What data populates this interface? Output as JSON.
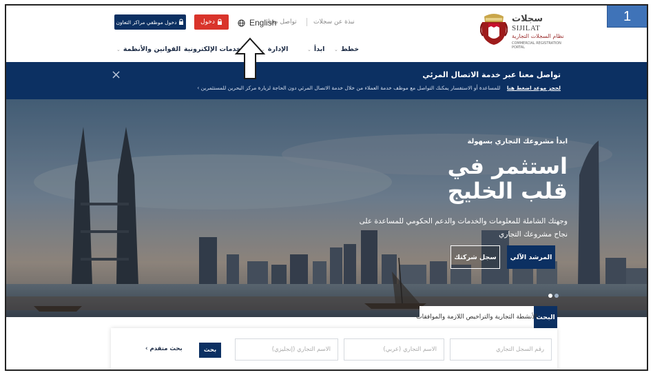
{
  "badge": {
    "label": "1"
  },
  "logo": {
    "arabic_title": "سجلات",
    "latin_title": "SIJILAT",
    "arabic_subtitle": "نظام السجلات التجارية",
    "english_line1": "COMMERCIAL REGISTRATION",
    "english_line2": "PORTAL"
  },
  "top_links": {
    "about": "نبذة عن سجلات",
    "contact": "تواصل معنا",
    "language": "English",
    "login": "دخول",
    "login_employees": "دخول موظفي مراكز التعاون"
  },
  "nav": {
    "items": [
      {
        "label": "خطط"
      },
      {
        "label": "ابدأ"
      },
      {
        "label": "الإدارة"
      },
      {
        "label": "الخدمات الإلكترونية"
      },
      {
        "label": "القوانين والأنظمة"
      }
    ]
  },
  "banner": {
    "title": "تواصل معنا عبر خدمة الاتصال المرئي",
    "text": "للمساعدة أو الاستفسار يمكنك التواصل مع موظف خدمة العملاء من خلال خدمة الاتصال المرئي دون الحاجة لزيارة مركز البحرين للمستثمرين",
    "link": "لحجز موعد اضغط هنا",
    "close": "×"
  },
  "hero": {
    "kicker": "ابدأ مشروعك التجاري بسهولة",
    "title_line1": "استثمر في",
    "title_line2": "قلب الخليج",
    "description": "وجهتك الشاملة للمعلومات والخدمات والدعم الحكومي للمساعدة على نجاح مشروعك التجاري",
    "guide_button": "المرشد الآلي",
    "register_button": "سجل شركتك"
  },
  "search": {
    "tab_search": "البحث",
    "tab_activities": "الأنشطة التجارية والتراخيص اللازمة والموافقات",
    "field_cr_number": "رقم السجل التجاري",
    "field_name_ar": "الاسم التجاري (عربي)",
    "field_name_en": "الاسم التجاري (إنجليزي)",
    "search_button": "بحث",
    "advanced_search": "بحث متقدم"
  },
  "colors": {
    "navy": "#0c3062",
    "red": "#d9342b",
    "badge": "#3f73b8"
  }
}
